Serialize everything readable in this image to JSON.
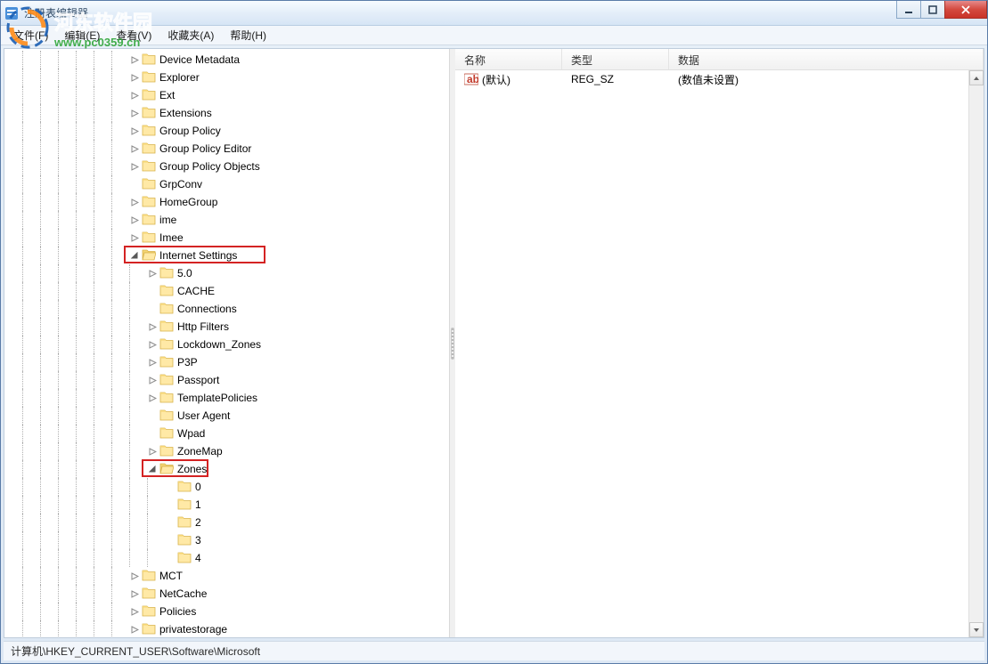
{
  "window": {
    "title": "注册表编辑器"
  },
  "menu": {
    "file": "文件(F)",
    "edit": "编辑(E)",
    "view": "查看(V)",
    "favorites": "收藏夹(A)",
    "help": "帮助(H)"
  },
  "tree": {
    "nodes": [
      {
        "level": 7,
        "exp": "closed",
        "label": "Device Metadata"
      },
      {
        "level": 7,
        "exp": "closed",
        "label": "Explorer"
      },
      {
        "level": 7,
        "exp": "closed",
        "label": "Ext"
      },
      {
        "level": 7,
        "exp": "closed",
        "label": "Extensions"
      },
      {
        "level": 7,
        "exp": "closed",
        "label": "Group Policy"
      },
      {
        "level": 7,
        "exp": "closed",
        "label": "Group Policy Editor"
      },
      {
        "level": 7,
        "exp": "closed",
        "label": "Group Policy Objects"
      },
      {
        "level": 7,
        "exp": "none",
        "label": "GrpConv"
      },
      {
        "level": 7,
        "exp": "closed",
        "label": "HomeGroup"
      },
      {
        "level": 7,
        "exp": "closed",
        "label": "ime"
      },
      {
        "level": 7,
        "exp": "closed",
        "label": "Imee"
      },
      {
        "level": 7,
        "exp": "open",
        "label": "Internet Settings",
        "highlight": true
      },
      {
        "level": 8,
        "exp": "closed",
        "label": "5.0"
      },
      {
        "level": 8,
        "exp": "none",
        "label": "CACHE"
      },
      {
        "level": 8,
        "exp": "none",
        "label": "Connections"
      },
      {
        "level": 8,
        "exp": "closed",
        "label": "Http Filters"
      },
      {
        "level": 8,
        "exp": "closed",
        "label": "Lockdown_Zones"
      },
      {
        "level": 8,
        "exp": "closed",
        "label": "P3P"
      },
      {
        "level": 8,
        "exp": "closed",
        "label": "Passport"
      },
      {
        "level": 8,
        "exp": "closed",
        "label": "TemplatePolicies"
      },
      {
        "level": 8,
        "exp": "none",
        "label": "User Agent"
      },
      {
        "level": 8,
        "exp": "none",
        "label": "Wpad"
      },
      {
        "level": 8,
        "exp": "closed",
        "label": "ZoneMap"
      },
      {
        "level": 8,
        "exp": "open",
        "label": "Zones",
        "highlight": true
      },
      {
        "level": 9,
        "exp": "none",
        "label": "0"
      },
      {
        "level": 9,
        "exp": "none",
        "label": "1"
      },
      {
        "level": 9,
        "exp": "none",
        "label": "2"
      },
      {
        "level": 9,
        "exp": "none",
        "label": "3"
      },
      {
        "level": 9,
        "exp": "none",
        "label": "4"
      },
      {
        "level": 7,
        "exp": "closed",
        "label": "MCT"
      },
      {
        "level": 7,
        "exp": "closed",
        "label": "NetCache"
      },
      {
        "level": 7,
        "exp": "closed",
        "label": "Policies"
      },
      {
        "level": 7,
        "exp": "closed",
        "label": "privatestorage"
      }
    ]
  },
  "list": {
    "headers": {
      "name": "名称",
      "type": "类型",
      "data": "数据"
    },
    "rows": [
      {
        "name": "(默认)",
        "type": "REG_SZ",
        "data": "(数值未设置)"
      }
    ]
  },
  "statusbar": {
    "path": "计算机\\HKEY_CURRENT_USER\\Software\\Microsoft"
  },
  "watermark": {
    "cn": "河东软件园"
  }
}
